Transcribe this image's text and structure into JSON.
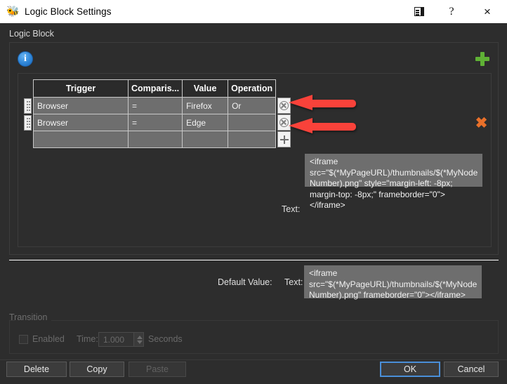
{
  "window": {
    "title": "Logic Block Settings",
    "app_icon": "bee-icon",
    "controls": {
      "dock": "dock-icon",
      "help": "?",
      "close": "×"
    }
  },
  "section": {
    "label": "Logic Block",
    "info_icon": "i",
    "add_icon": "plus-icon",
    "delete_icon": "✖"
  },
  "table": {
    "headers": [
      "Trigger",
      "Comparis...",
      "Value",
      "Operation"
    ],
    "rows": [
      {
        "trigger": "Browser",
        "comparison": "=",
        "value": "Firefox",
        "operation": "Or"
      },
      {
        "trigger": "Browser",
        "comparison": "=",
        "value": "Edge",
        "operation": ""
      },
      {
        "trigger": "",
        "comparison": "",
        "value": "",
        "operation": ""
      }
    ]
  },
  "condition_text": {
    "label": "Text:",
    "value": "<iframe src=\"$(*MyPageURL)/thumbnails/$(*MyNodeNumber).png\" style=\"margin-left: -8px; margin-top: -8px;\" frameborder=\"0\"></iframe>"
  },
  "default_value": {
    "label": "Default Value:",
    "text_label": "Text:",
    "value": "<iframe src=\"$(*MyPageURL)/thumbnails/$(*MyNodeNumber).png\" frameborder=\"0\"></iframe>"
  },
  "transition": {
    "group_label": "Transition",
    "enabled_label": "Enabled",
    "enabled_checked": false,
    "time_label": "Time:",
    "time_value": "1.000",
    "seconds_label": "Seconds"
  },
  "buttons": {
    "delete": "Delete",
    "copy": "Copy",
    "paste": "Paste",
    "ok": "OK",
    "cancel": "Cancel"
  },
  "annotations": {
    "arrow_color": "#f9423a",
    "arrow_count": 2
  },
  "colors": {
    "titlebar_bg": "#ffffff",
    "window_bg": "#2d2d2d",
    "field_bg": "#6e6e6e",
    "accent_blue": "#4a8fd8",
    "accent_green": "#5fb135",
    "accent_orange": "#e8702a",
    "annotation_red": "#f9423a"
  }
}
